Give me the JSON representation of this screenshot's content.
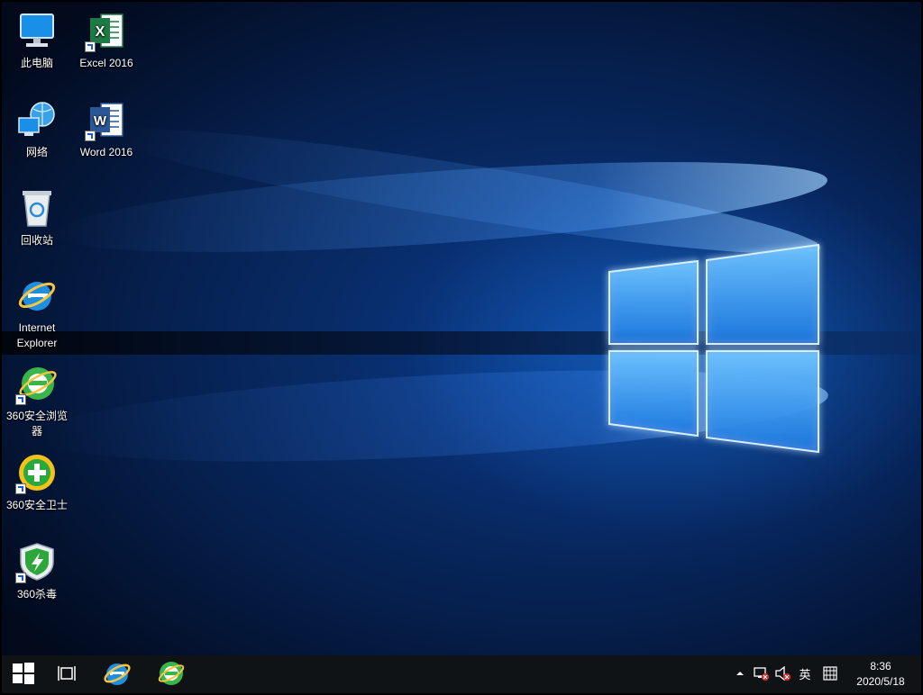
{
  "desktop": {
    "icons": [
      {
        "label": "此电脑",
        "icon": "this-pc-icon"
      },
      {
        "label": "网络",
        "icon": "network-icon"
      },
      {
        "label": "回收站",
        "icon": "recycle-bin-icon"
      },
      {
        "label": "Internet Explorer",
        "icon": "internet-explorer-icon"
      },
      {
        "label": "360安全浏览器",
        "icon": "360-browser-icon"
      },
      {
        "label": "360安全卫士",
        "icon": "360-safe-guard-icon"
      },
      {
        "label": "360杀毒",
        "icon": "360-antivirus-icon"
      },
      {
        "label": "Excel 2016",
        "icon": "excel-icon"
      },
      {
        "label": "Word 2016",
        "icon": "word-icon"
      }
    ]
  },
  "taskbar": {
    "start": {
      "icon": "windows-start-icon"
    },
    "task_view": {
      "icon": "task-view-icon"
    },
    "pinned": [
      {
        "icon": "internet-explorer-icon"
      },
      {
        "icon": "360-browser-icon"
      }
    ],
    "tray": {
      "chevron_icon": "chevron-up-icon",
      "network_icon": "network-disconnected-icon",
      "volume_icon": "volume-muted-icon",
      "ime_label": "英",
      "ime_mode_icon": "ime-mode-icon",
      "time": "8:36",
      "date": "2020/5/18"
    }
  },
  "colors": {
    "taskbar_bg": "#101316",
    "accent_blue": "#1f8cff",
    "excel_green": "#1d7a44",
    "word_blue": "#2b5797"
  }
}
